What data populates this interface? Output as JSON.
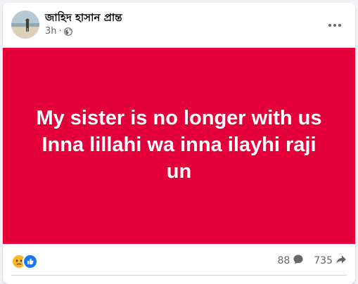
{
  "post": {
    "author": "জাহিদ হাসান প্রান্ত",
    "time": "3h",
    "separator": "·",
    "audience_icon": "globe-icon",
    "more_icon": "more-dots-icon",
    "banner_color": "#e4003b",
    "banner_lines": [
      "My sister is no longer with us",
      "Inna lillahi wa inna ilayhi raji",
      "un"
    ]
  },
  "footer": {
    "reaction_icons": [
      "sad-reaction-icon",
      "like-reaction-icon"
    ],
    "comments_count": "88",
    "comments_icon": "comment-icon",
    "shares_count": "735",
    "shares_icon": "share-icon"
  }
}
